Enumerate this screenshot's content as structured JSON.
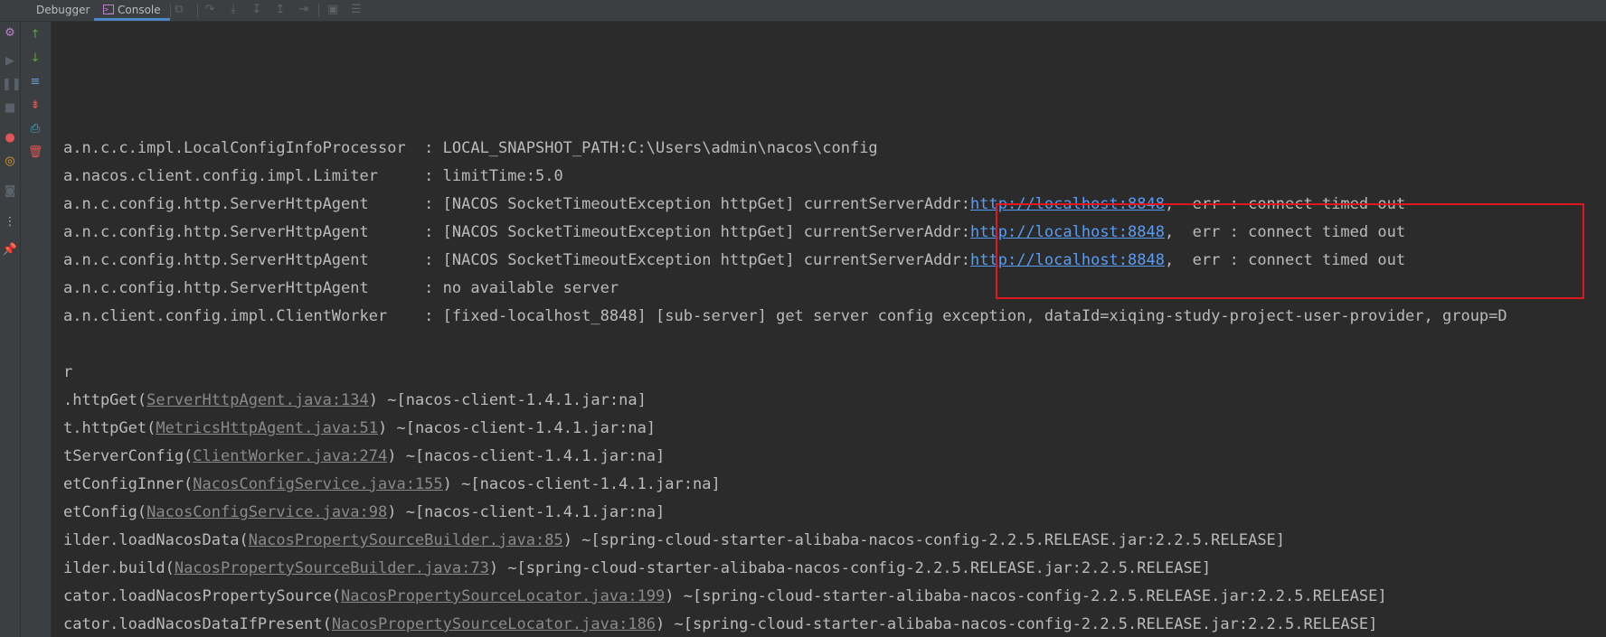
{
  "toolbar": {
    "tabs": [
      {
        "label": "Debugger"
      },
      {
        "label": "Console",
        "icon": "console-icon",
        "active": true
      }
    ],
    "icons": [
      "restore-layout-icon",
      "step-over-icon",
      "step-into-icon",
      "force-step-into-icon",
      "step-out-icon",
      "run-to-cursor-icon",
      "evaluate-expression-icon",
      "trace-icon"
    ]
  },
  "sidebar_icons": [
    "debug-icon",
    "settings-icon",
    "resume-icon",
    "pause-icon",
    "stop-icon",
    "view-breakpoints-icon",
    "mute-breakpoints-icon",
    "camera-icon",
    "more-icon",
    "pin-icon"
  ],
  "console_toolbar_icons": [
    "scroll-up-icon",
    "scroll-down-icon",
    "soft-wrap-icon",
    "scroll-to-end-icon",
    "print-icon",
    "clear-icon"
  ],
  "colors": {
    "background": "#2b2b2b",
    "panel": "#3c3f41",
    "text": "#bbbbbb",
    "link": "#589df6",
    "highlight_box": "#e0171d",
    "accent_tab": "#4a88c7"
  },
  "console": {
    "lines": [
      {
        "prefix": "a.n.c.c.impl.LocalConfigInfoProcessor  : LOCAL_SNAPSHOT_PATH:C:\\Users\\admin\\nacos\\config"
      },
      {
        "prefix": "a.nacos.client.config.impl.Limiter     : limitTime:5.0"
      },
      {
        "prefix": "a.n.c.config.http.ServerHttpAgent      : [NACOS SocketTimeoutException httpGet] currentServerAddr:",
        "link": "http://localhost:8848",
        "suffix": ",  err : connect timed out"
      },
      {
        "prefix": "a.n.c.config.http.ServerHttpAgent      : [NACOS SocketTimeoutException httpGet] currentServerAddr:",
        "link": "http://localhost:8848",
        "suffix": ",  err : connect timed out"
      },
      {
        "prefix": "a.n.c.config.http.ServerHttpAgent      : [NACOS SocketTimeoutException httpGet] currentServerAddr:",
        "link": "http://localhost:8848",
        "suffix": ",  err : connect timed out"
      },
      {
        "prefix": "a.n.c.config.http.ServerHttpAgent      : no available server"
      },
      {
        "prefix": "a.n.client.config.impl.ClientWorker    : [fixed-localhost_8848] [sub-server] get server config exception, dataId=xiqing-study-project-user-provider, group=D"
      },
      {
        "prefix": ""
      },
      {
        "prefix": "r"
      },
      {
        "prefix": ".httpGet(",
        "link": "ServerHttpAgent.java:134",
        "suffix": ") ~[nacos-client-1.4.1.jar:na]"
      },
      {
        "prefix": "t.httpGet(",
        "link": "MetricsHttpAgent.java:51",
        "suffix": ") ~[nacos-client-1.4.1.jar:na]"
      },
      {
        "prefix": "tServerConfig(",
        "link": "ClientWorker.java:274",
        "suffix": ") ~[nacos-client-1.4.1.jar:na]"
      },
      {
        "prefix": "etConfigInner(",
        "link": "NacosConfigService.java:155",
        "suffix": ") ~[nacos-client-1.4.1.jar:na]"
      },
      {
        "prefix": "etConfig(",
        "link": "NacosConfigService.java:98",
        "suffix": ") ~[nacos-client-1.4.1.jar:na]"
      },
      {
        "prefix": "ilder.loadNacosData(",
        "link": "NacosPropertySourceBuilder.java:85",
        "suffix": ") ~[spring-cloud-starter-alibaba-nacos-config-2.2.5.RELEASE.jar:2.2.5.RELEASE]"
      },
      {
        "prefix": "ilder.build(",
        "link": "NacosPropertySourceBuilder.java:73",
        "suffix": ") ~[spring-cloud-starter-alibaba-nacos-config-2.2.5.RELEASE.jar:2.2.5.RELEASE]"
      },
      {
        "prefix": "cator.loadNacosPropertySource(",
        "link": "NacosPropertySourceLocator.java:199",
        "suffix": ") ~[spring-cloud-starter-alibaba-nacos-config-2.2.5.RELEASE.jar:2.2.5.RELEASE]"
      },
      {
        "prefix": "cator.loadNacosDataIfPresent(",
        "link": "NacosPropertySourceLocator.java:186",
        "suffix": ") ~[spring-cloud-starter-alibaba-nacos-config-2.2.5.RELEASE.jar:2.2.5.RELEASE]"
      }
    ]
  }
}
